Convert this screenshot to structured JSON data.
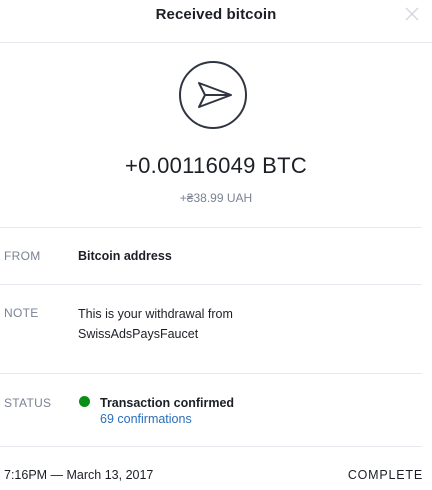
{
  "header": {
    "title": "Received bitcoin",
    "close_icon": "close-icon"
  },
  "transaction": {
    "icon": "send-arrow-icon",
    "amount": "+0.00116049 BTC",
    "native_amount": "+₴38.99 UAH"
  },
  "details": {
    "from_label": "FROM",
    "from_value": "Bitcoin address",
    "note_label": "NOTE",
    "note_value": "This is your withdrawal from SwissAdsPaysFaucet",
    "status_label": "STATUS",
    "status_value": "Transaction confirmed",
    "status_color": "#0a8e18",
    "confirmations": "69 confirmations"
  },
  "footer": {
    "timestamp": "7:16PM — March 13, 2017",
    "state": "COMPLETE"
  }
}
